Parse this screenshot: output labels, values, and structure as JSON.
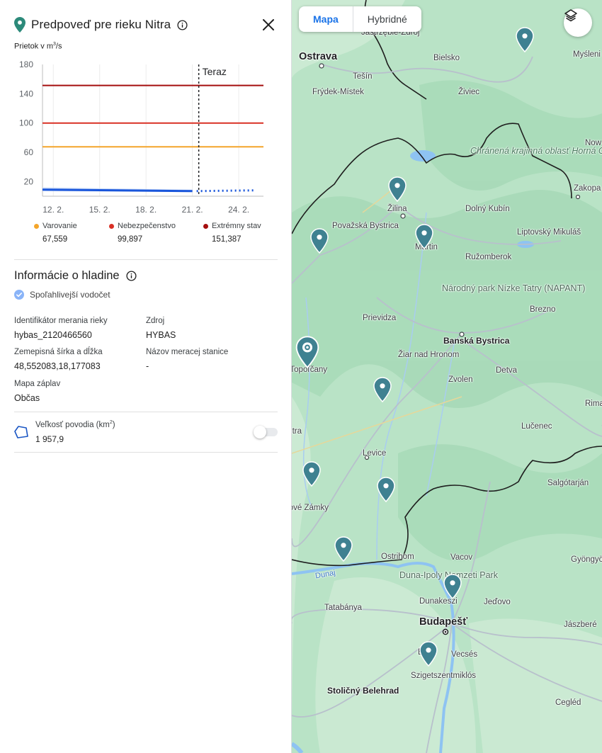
{
  "panel": {
    "title": "Predpoveď pre rieku Nitra",
    "flow_label_prefix": "Prietok v m",
    "flow_label_suffix": "/s",
    "flow_label_exp": "3",
    "legend": [
      {
        "name": "Varovanie",
        "value": "67,559",
        "color": "#f4a52b"
      },
      {
        "name": "Nebezpečenstvo",
        "value": "99,897",
        "color": "#d93025"
      },
      {
        "name": "Extrémny stav",
        "value": "151,387",
        "color": "#a50e0e"
      }
    ],
    "section_title": "Informácie o hladine",
    "verified": "Spoľahlivejší vodočet",
    "fields": {
      "id_key": "Identifikátor merania rieky",
      "id_val": "hybas_2120466560",
      "source_key": "Zdroj",
      "source_val": "HYBAS",
      "coords_key": "Zemepisná šírka a dĺžka",
      "coords_val": "48,552083,18,177083",
      "station_key": "Názov meracej stanice",
      "station_val": "-",
      "flood_key": "Mapa záplav",
      "flood_val": "Občas"
    },
    "basin_key": "Veľkosť povodia (km",
    "basin_key_suffix": ")",
    "basin_key_exp": "2",
    "basin_val": "1 957,9"
  },
  "chart_data": {
    "type": "line",
    "title": "",
    "ylabel": "Prietok v m3/s",
    "ylim": [
      0,
      180
    ],
    "yticks": [
      "180",
      "140",
      "100",
      "60",
      "20"
    ],
    "x_ticks": [
      "12. 2.",
      "15. 2.",
      "18. 2.",
      "21. 2.",
      "24. 2."
    ],
    "now_label": "Teraz",
    "now_x": "21. 2.",
    "thresholds": [
      {
        "name": "Varovanie",
        "value": 67.559,
        "color": "#f4a52b"
      },
      {
        "name": "Nebezpečenstvo",
        "value": 99.897,
        "color": "#d93025"
      },
      {
        "name": "Extrémny stav",
        "value": 151.387,
        "color": "#a50e0e"
      }
    ],
    "series": [
      {
        "x": [
          "11. 2.",
          "21. 2."
        ],
        "values": [
          9,
          7
        ]
      },
      {
        "x": [
          "21. 2.",
          "25. 2."
        ],
        "values": [
          7,
          8
        ]
      }
    ]
  },
  "map": {
    "tabs": [
      "Mapa",
      "Hybridné"
    ],
    "labels": [
      {
        "t": "Jastrzębie-Zdrój",
        "c": ""
      },
      {
        "t": "Ostrava",
        "c": "city"
      },
      {
        "t": "Bielsko",
        "c": ""
      },
      {
        "t": "Myśleni",
        "c": ""
      },
      {
        "t": "Tešín",
        "c": ""
      },
      {
        "t": "Frýdek-Místek",
        "c": ""
      },
      {
        "t": "Živiec",
        "c": ""
      },
      {
        "t": "Now",
        "c": ""
      },
      {
        "t": "Chránená krajinná oblasť Horná Orava",
        "c": "park"
      },
      {
        "t": "Zakopa",
        "c": ""
      },
      {
        "t": "Žilina",
        "c": ""
      },
      {
        "t": "Dolný Kubín",
        "c": ""
      },
      {
        "t": "Považská Bystrica",
        "c": ""
      },
      {
        "t": "Liptovský Mikuláš",
        "c": ""
      },
      {
        "t": "Martin",
        "c": ""
      },
      {
        "t": "Ružomberok",
        "c": ""
      },
      {
        "t": "Národný park Nízke Tatry (NAPANT)",
        "c": "park2"
      },
      {
        "t": "Brezno",
        "c": ""
      },
      {
        "t": "Prievidza",
        "c": ""
      },
      {
        "t": "Banská Bystrica",
        "c": "bold"
      },
      {
        "t": "Žiar nad Hronom",
        "c": ""
      },
      {
        "t": "Topoľčany",
        "c": ""
      },
      {
        "t": "Detva",
        "c": ""
      },
      {
        "t": "Zvolen",
        "c": ""
      },
      {
        "t": "Rima",
        "c": ""
      },
      {
        "t": "Lučenec",
        "c": ""
      },
      {
        "t": "Nitra",
        "c": ""
      },
      {
        "t": "Levice",
        "c": ""
      },
      {
        "t": "Salgótarján",
        "c": ""
      },
      {
        "t": "Nové Zámky",
        "c": ""
      },
      {
        "t": "Ostrihom",
        "c": ""
      },
      {
        "t": "Vacov",
        "c": ""
      },
      {
        "t": "Gyöngyö",
        "c": ""
      },
      {
        "t": "Duna-Ipoly Nemzeti Park",
        "c": "park2"
      },
      {
        "t": "Dunaj",
        "c": "water"
      },
      {
        "t": "Tatabánya",
        "c": ""
      },
      {
        "t": "Dunakeszi",
        "c": ""
      },
      {
        "t": "Jeďovo",
        "c": ""
      },
      {
        "t": "Budapešť",
        "c": "city"
      },
      {
        "t": "Jászberé",
        "c": ""
      },
      {
        "t": "Érd",
        "c": ""
      },
      {
        "t": "Vecsés",
        "c": ""
      },
      {
        "t": "Szigetszentmiklós",
        "c": ""
      },
      {
        "t": "Stoličný Belehrad",
        "c": "bold"
      },
      {
        "t": "Cegléd",
        "c": ""
      }
    ],
    "pin_color": "#3f8191"
  }
}
